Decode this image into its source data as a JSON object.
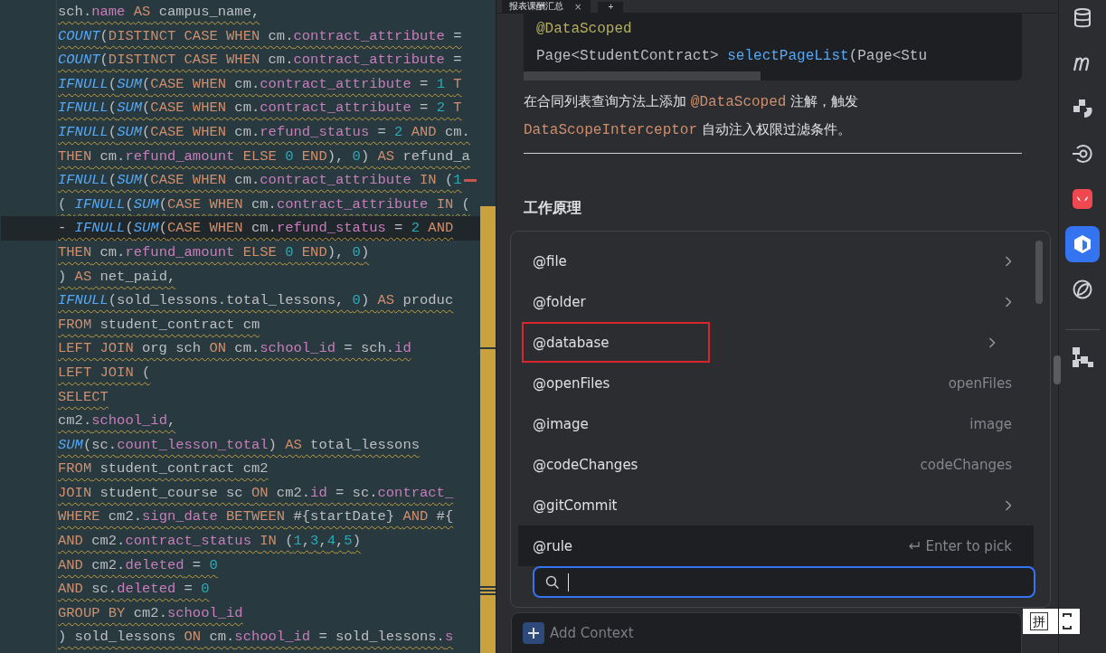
{
  "editor": {
    "lines": [
      {
        "current": false,
        "error_mark": false,
        "tokens": [
          {
            "kind": "plain",
            "text": "sch."
          },
          {
            "kind": "field",
            "text": "name "
          },
          {
            "kind": "keyword",
            "text": "AS"
          },
          {
            "kind": "plain",
            "text": " campus_name,"
          }
        ]
      },
      {
        "current": false,
        "error_mark": false,
        "tokens": [
          {
            "kind": "function",
            "text": "COUNT"
          },
          {
            "kind": "plain",
            "text": "("
          },
          {
            "kind": "keyword",
            "text": "DISTINCT CASE WHEN"
          },
          {
            "kind": "plain",
            "text": " cm."
          },
          {
            "kind": "field",
            "text": "contract_attribute"
          },
          {
            "kind": "plain",
            "text": " ="
          }
        ]
      },
      {
        "current": false,
        "error_mark": false,
        "tokens": [
          {
            "kind": "function",
            "text": "COUNT"
          },
          {
            "kind": "plain",
            "text": "("
          },
          {
            "kind": "keyword",
            "text": "DISTINCT CASE WHEN"
          },
          {
            "kind": "plain",
            "text": " cm."
          },
          {
            "kind": "field",
            "text": "contract_attribute"
          },
          {
            "kind": "plain",
            "text": " ="
          }
        ]
      },
      {
        "current": false,
        "error_mark": false,
        "tokens": [
          {
            "kind": "function",
            "text": "IFNULL"
          },
          {
            "kind": "plain",
            "text": "("
          },
          {
            "kind": "function",
            "text": "SUM"
          },
          {
            "kind": "plain",
            "text": "("
          },
          {
            "kind": "keyword",
            "text": "CASE WHEN"
          },
          {
            "kind": "plain",
            "text": " cm."
          },
          {
            "kind": "field",
            "text": "contract_attribute"
          },
          {
            "kind": "plain",
            "text": " = "
          },
          {
            "kind": "number",
            "text": "1 "
          },
          {
            "kind": "keyword",
            "text": "T"
          }
        ]
      },
      {
        "current": false,
        "error_mark": false,
        "tokens": [
          {
            "kind": "function",
            "text": "IFNULL"
          },
          {
            "kind": "plain",
            "text": "("
          },
          {
            "kind": "function",
            "text": "SUM"
          },
          {
            "kind": "plain",
            "text": "("
          },
          {
            "kind": "keyword",
            "text": "CASE WHEN"
          },
          {
            "kind": "plain",
            "text": " cm."
          },
          {
            "kind": "field",
            "text": "contract_attribute"
          },
          {
            "kind": "plain",
            "text": " = "
          },
          {
            "kind": "number",
            "text": "2 "
          },
          {
            "kind": "keyword",
            "text": "T"
          }
        ]
      },
      {
        "current": false,
        "error_mark": false,
        "tokens": [
          {
            "kind": "function",
            "text": "IFNULL"
          },
          {
            "kind": "plain",
            "text": "("
          },
          {
            "kind": "function",
            "text": "SUM"
          },
          {
            "kind": "plain",
            "text": "("
          },
          {
            "kind": "keyword",
            "text": "CASE WHEN"
          },
          {
            "kind": "plain",
            "text": " cm."
          },
          {
            "kind": "field",
            "text": "refund_status"
          },
          {
            "kind": "plain",
            "text": " = "
          },
          {
            "kind": "number",
            "text": "2 "
          },
          {
            "kind": "keyword",
            "text": "AND"
          },
          {
            "kind": "plain",
            "text": " cm."
          }
        ]
      },
      {
        "current": false,
        "error_mark": false,
        "tokens": [
          {
            "kind": "keyword",
            "text": "THEN"
          },
          {
            "kind": "plain",
            "text": " cm."
          },
          {
            "kind": "field",
            "text": "refund_amount "
          },
          {
            "kind": "keyword",
            "text": "ELSE "
          },
          {
            "kind": "number",
            "text": "0 "
          },
          {
            "kind": "keyword",
            "text": "END"
          },
          {
            "kind": "plain",
            "text": "), "
          },
          {
            "kind": "number",
            "text": "0"
          },
          {
            "kind": "plain",
            "text": ") "
          },
          {
            "kind": "keyword",
            "text": "AS"
          },
          {
            "kind": "plain",
            "text": " refund_a"
          }
        ]
      },
      {
        "current": false,
        "error_mark": true,
        "tokens": [
          {
            "kind": "function",
            "text": "IFNULL"
          },
          {
            "kind": "plain",
            "text": "("
          },
          {
            "kind": "function",
            "text": "SUM"
          },
          {
            "kind": "plain",
            "text": "("
          },
          {
            "kind": "keyword",
            "text": "CASE WHEN"
          },
          {
            "kind": "plain",
            "text": " cm."
          },
          {
            "kind": "field",
            "text": "contract_attribute "
          },
          {
            "kind": "keyword",
            "text": "IN"
          },
          {
            "kind": "plain",
            "text": " ("
          },
          {
            "kind": "number",
            "text": "1"
          }
        ]
      },
      {
        "current": false,
        "error_mark": false,
        "tokens": [
          {
            "kind": "plain",
            "text": "( "
          },
          {
            "kind": "function",
            "text": "IFNULL"
          },
          {
            "kind": "plain",
            "text": "("
          },
          {
            "kind": "function",
            "text": "SUM"
          },
          {
            "kind": "plain",
            "text": "("
          },
          {
            "kind": "keyword",
            "text": "CASE WHEN"
          },
          {
            "kind": "plain",
            "text": " cm."
          },
          {
            "kind": "field",
            "text": "contract_attribute "
          },
          {
            "kind": "keyword",
            "text": "IN"
          },
          {
            "kind": "plain",
            "text": " ("
          }
        ]
      },
      {
        "current": true,
        "error_mark": false,
        "tokens": [
          {
            "kind": "plain",
            "text": "- "
          },
          {
            "kind": "function",
            "text": "IFNULL"
          },
          {
            "kind": "plain",
            "text": "("
          },
          {
            "kind": "function",
            "text": "SUM"
          },
          {
            "kind": "plain",
            "text": "("
          },
          {
            "kind": "keyword",
            "text": "CASE WHEN"
          },
          {
            "kind": "plain",
            "text": " cm."
          },
          {
            "kind": "field",
            "text": "refund_status"
          },
          {
            "kind": "plain",
            "text": " = "
          },
          {
            "kind": "number",
            "text": "2 "
          },
          {
            "kind": "keyword",
            "text": "AND"
          }
        ]
      },
      {
        "current": false,
        "error_mark": false,
        "tokens": [
          {
            "kind": "keyword",
            "text": "THEN"
          },
          {
            "kind": "plain",
            "text": " cm."
          },
          {
            "kind": "field",
            "text": "refund_amount "
          },
          {
            "kind": "keyword",
            "text": "ELSE "
          },
          {
            "kind": "number",
            "text": "0 "
          },
          {
            "kind": "keyword",
            "text": "END"
          },
          {
            "kind": "plain",
            "text": "), "
          },
          {
            "kind": "number",
            "text": "0"
          },
          {
            "kind": "plain",
            "text": ")"
          }
        ]
      },
      {
        "current": false,
        "error_mark": false,
        "tokens": [
          {
            "kind": "plain",
            "text": ") "
          },
          {
            "kind": "keyword",
            "text": "AS"
          },
          {
            "kind": "plain",
            "text": " net_paid,"
          }
        ]
      },
      {
        "current": false,
        "error_mark": false,
        "tokens": [
          {
            "kind": "function",
            "text": "IFNULL"
          },
          {
            "kind": "plain",
            "text": "(sold_lessons.total_lessons, "
          },
          {
            "kind": "number",
            "text": "0"
          },
          {
            "kind": "plain",
            "text": ") "
          },
          {
            "kind": "keyword",
            "text": "AS"
          },
          {
            "kind": "plain",
            "text": " produc"
          }
        ]
      },
      {
        "current": false,
        "error_mark": false,
        "tokens": [
          {
            "kind": "keyword",
            "text": "FROM"
          },
          {
            "kind": "plain",
            "text": " student_contract cm"
          }
        ]
      },
      {
        "current": false,
        "error_mark": false,
        "tokens": [
          {
            "kind": "keyword",
            "text": "LEFT JOIN"
          },
          {
            "kind": "plain",
            "text": " org sch "
          },
          {
            "kind": "keyword",
            "text": "ON"
          },
          {
            "kind": "plain",
            "text": " cm."
          },
          {
            "kind": "field",
            "text": "school_id"
          },
          {
            "kind": "plain",
            "text": " = sch."
          },
          {
            "kind": "field",
            "text": "id"
          }
        ]
      },
      {
        "current": false,
        "error_mark": false,
        "tokens": [
          {
            "kind": "keyword",
            "text": "LEFT JOIN"
          },
          {
            "kind": "plain",
            "text": " ("
          }
        ]
      },
      {
        "current": false,
        "error_mark": false,
        "tokens": [
          {
            "kind": "keyword",
            "text": "SELECT"
          }
        ]
      },
      {
        "current": false,
        "error_mark": false,
        "tokens": [
          {
            "kind": "plain",
            "text": "cm2."
          },
          {
            "kind": "field",
            "text": "school_id"
          },
          {
            "kind": "plain",
            "text": ","
          }
        ]
      },
      {
        "current": false,
        "error_mark": false,
        "tokens": [
          {
            "kind": "function",
            "text": "SUM"
          },
          {
            "kind": "plain",
            "text": "(sc."
          },
          {
            "kind": "field",
            "text": "count_lesson_total"
          },
          {
            "kind": "plain",
            "text": ") "
          },
          {
            "kind": "keyword",
            "text": "AS"
          },
          {
            "kind": "plain",
            "text": " total_lessons"
          }
        ]
      },
      {
        "current": false,
        "error_mark": false,
        "tokens": [
          {
            "kind": "keyword",
            "text": "FROM"
          },
          {
            "kind": "plain",
            "text": " student_contract cm2"
          }
        ]
      },
      {
        "current": false,
        "error_mark": false,
        "tokens": [
          {
            "kind": "keyword",
            "text": "JOIN"
          },
          {
            "kind": "plain",
            "text": " student_course sc "
          },
          {
            "kind": "keyword",
            "text": "ON"
          },
          {
            "kind": "plain",
            "text": " cm2."
          },
          {
            "kind": "field",
            "text": "id"
          },
          {
            "kind": "plain",
            "text": " = sc."
          },
          {
            "kind": "field",
            "text": "contract_"
          }
        ]
      },
      {
        "current": false,
        "error_mark": false,
        "tokens": [
          {
            "kind": "keyword",
            "text": "WHERE"
          },
          {
            "kind": "plain",
            "text": " cm2."
          },
          {
            "kind": "field",
            "text": "sign_date "
          },
          {
            "kind": "keyword",
            "text": "BETWEEN"
          },
          {
            "kind": "plain",
            "text": " #{startDate} "
          },
          {
            "kind": "keyword",
            "text": "AND"
          },
          {
            "kind": "plain",
            "text": " #{"
          }
        ]
      },
      {
        "current": false,
        "error_mark": false,
        "tokens": [
          {
            "kind": "keyword",
            "text": "AND"
          },
          {
            "kind": "plain",
            "text": " cm2."
          },
          {
            "kind": "field",
            "text": "contract_status "
          },
          {
            "kind": "keyword",
            "text": "IN"
          },
          {
            "kind": "plain",
            "text": " ("
          },
          {
            "kind": "number",
            "text": "1"
          },
          {
            "kind": "plain",
            "text": ","
          },
          {
            "kind": "number",
            "text": "3"
          },
          {
            "kind": "plain",
            "text": ","
          },
          {
            "kind": "number",
            "text": "4"
          },
          {
            "kind": "plain",
            "text": ","
          },
          {
            "kind": "number",
            "text": "5"
          },
          {
            "kind": "plain",
            "text": ")"
          }
        ]
      },
      {
        "current": false,
        "error_mark": false,
        "tokens": [
          {
            "kind": "keyword",
            "text": "AND"
          },
          {
            "kind": "plain",
            "text": " cm2."
          },
          {
            "kind": "field",
            "text": "deleted"
          },
          {
            "kind": "plain",
            "text": " = "
          },
          {
            "kind": "number",
            "text": "0"
          }
        ]
      },
      {
        "current": false,
        "error_mark": false,
        "tokens": [
          {
            "kind": "keyword",
            "text": "AND"
          },
          {
            "kind": "plain",
            "text": " sc."
          },
          {
            "kind": "field",
            "text": "deleted"
          },
          {
            "kind": "plain",
            "text": " = "
          },
          {
            "kind": "number",
            "text": "0"
          }
        ]
      },
      {
        "current": false,
        "error_mark": false,
        "tokens": [
          {
            "kind": "keyword",
            "text": "GROUP BY"
          },
          {
            "kind": "plain",
            "text": " cm2."
          },
          {
            "kind": "field",
            "text": "school_id"
          }
        ]
      },
      {
        "current": false,
        "error_mark": false,
        "tokens": [
          {
            "kind": "plain",
            "text": ") sold_lessons "
          },
          {
            "kind": "keyword",
            "text": "ON"
          },
          {
            "kind": "plain",
            "text": " cm."
          },
          {
            "kind": "field",
            "text": "school_id"
          },
          {
            "kind": "plain",
            "text": " = sold_lessons."
          },
          {
            "kind": "field",
            "text": "s"
          }
        ]
      }
    ]
  },
  "chat": {
    "tab": {
      "label": "报表课酬汇总",
      "close": "×",
      "add": "+"
    },
    "code_block": [
      [
        {
          "kind": "annotation",
          "text": "@DataScoped"
        }
      ],
      [
        {
          "kind": "plain",
          "text": "Page<StudentContract> "
        },
        {
          "kind": "method",
          "text": "selectPageList"
        },
        {
          "kind": "plain",
          "text": "(Page<Stu"
        }
      ]
    ],
    "paragraph": [
      {
        "kind": "text",
        "text": "在合同列表查询方法上添加 "
      },
      {
        "kind": "code",
        "text": "@DataScoped"
      },
      {
        "kind": "text",
        "text": " 注解，触发 "
      },
      {
        "kind": "code",
        "text": "DataScopeInterceptor"
      },
      {
        "kind": "text",
        "text": " 自动注入权限过滤条件。"
      }
    ],
    "heading": "工作原理",
    "add_context": "Add Context"
  },
  "popup": {
    "items": [
      {
        "label": "@file",
        "kind": "submenu",
        "selected": false,
        "outlined": false
      },
      {
        "label": "@folder",
        "kind": "submenu",
        "selected": false,
        "outlined": false
      },
      {
        "label": "@database",
        "kind": "submenu",
        "selected": false,
        "outlined": true
      },
      {
        "label": "@openFiles",
        "kind": "hint",
        "hint": "openFiles",
        "selected": false,
        "outlined": false
      },
      {
        "label": "@image",
        "kind": "hint",
        "hint": "image",
        "selected": false,
        "outlined": false
      },
      {
        "label": "@codeChanges",
        "kind": "hint",
        "hint": "codeChanges",
        "selected": false,
        "outlined": false
      },
      {
        "label": "@gitCommit",
        "kind": "submenu",
        "selected": false,
        "outlined": false
      },
      {
        "label": "@rule",
        "kind": "hint",
        "hint": "Enter to pick",
        "selected": true,
        "outlined": false
      }
    ]
  },
  "ime": {
    "label": "拼"
  },
  "sidebar": [
    {
      "selected": false
    },
    {
      "selected": false
    },
    {
      "selected": false
    },
    {
      "selected": false
    },
    {
      "selected": false
    },
    {
      "selected": true
    },
    {
      "selected": false
    },
    {
      "selected": false
    }
  ]
}
